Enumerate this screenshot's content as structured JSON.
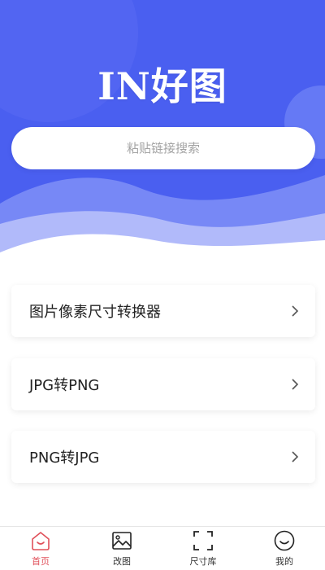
{
  "app": {
    "logo_text": "IN好图"
  },
  "search": {
    "placeholder": "粘贴链接搜索"
  },
  "tools": [
    {
      "label": "图片像素尺寸转换器"
    },
    {
      "label": "JPG转PNG"
    },
    {
      "label": "PNG转JPG"
    }
  ],
  "tabbar": [
    {
      "label": "首页",
      "icon": "home-icon",
      "active": true
    },
    {
      "label": "改图",
      "icon": "image-icon",
      "active": false
    },
    {
      "label": "尺寸库",
      "icon": "frame-icon",
      "active": false
    },
    {
      "label": "我的",
      "icon": "smile-icon",
      "active": false
    }
  ],
  "colors": {
    "primary": "#4a5ff0",
    "primary_light": "#6c7ff6",
    "active_tab": "#e0505a",
    "text": "#222222"
  }
}
